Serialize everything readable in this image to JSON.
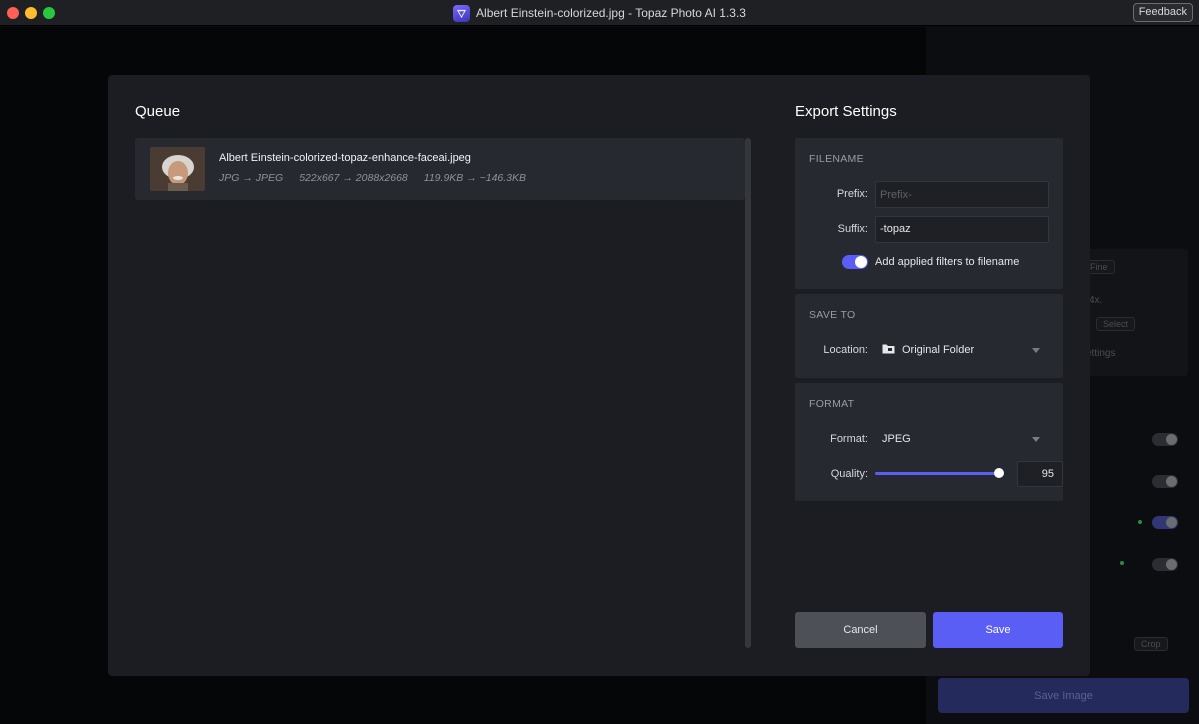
{
  "window": {
    "title": "Albert Einstein-colorized.jpg - Topaz Photo AI 1.3.3",
    "feedback_label": "Feedback"
  },
  "background": {
    "pill_fine": "Fine",
    "text_4x": "4x.",
    "pill_select": "Select",
    "text_settings": "ettings",
    "pill_crop": "Crop",
    "save_image_label": "Save Image"
  },
  "queue": {
    "title": "Queue",
    "items": [
      {
        "filename": "Albert Einstein-colorized-topaz-enhance-faceai.jpeg",
        "format_change": "JPG → JPEG",
        "dimensions_change": "522x667 → 2088x2668",
        "size_change": "119.9KB → ~146.3KB"
      }
    ]
  },
  "export": {
    "title": "Export Settings",
    "filename": {
      "heading": "FILENAME",
      "prefix_label": "Prefix:",
      "prefix_value": "",
      "prefix_placeholder": "Prefix-",
      "suffix_label": "Suffix:",
      "suffix_value": "-topaz",
      "add_filters_label": "Add applied filters to filename",
      "add_filters_on": true
    },
    "save_to": {
      "heading": "SAVE TO",
      "location_label": "Location:",
      "location_value": "Original Folder"
    },
    "format": {
      "heading": "FORMAT",
      "format_label": "Format:",
      "format_value": "JPEG",
      "quality_label": "Quality:",
      "quality_value": "95",
      "quality_fraction": 0.95
    },
    "cancel_label": "Cancel",
    "save_label": "Save"
  },
  "colors": {
    "accent": "#5b5ef5",
    "modal_bg": "#1b1d22",
    "section_bg": "#262930"
  }
}
